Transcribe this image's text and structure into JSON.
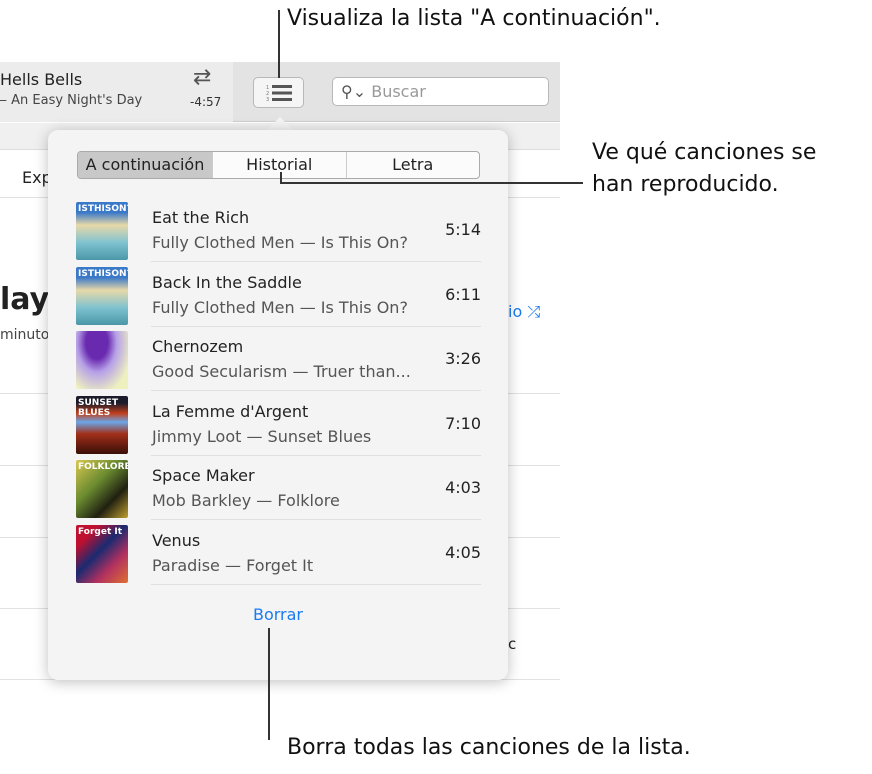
{
  "callouts": {
    "queue": "Visualiza la lista \"A continuación\".",
    "history_1": "Ve qué canciones se",
    "history_2": "han reproducido.",
    "clear": "Borra todas las canciones de la lista."
  },
  "now_playing": {
    "title": "Hells Bells",
    "subtitle": "— An Easy Night's Day",
    "remaining": "-4:57",
    "repeat_icon": "repeat-icon"
  },
  "search": {
    "placeholder": "Buscar",
    "icon": "search-icon"
  },
  "background": {
    "tab_fragment": "Exp",
    "title_fragment": "layl",
    "meta_fragment": "minuto",
    "shuffle_fragment": "io",
    "genre_fragment": "c"
  },
  "popover": {
    "tabs": [
      "A continuación",
      "Historial",
      "Letra"
    ],
    "selected_tab": "A continuación",
    "songs": [
      {
        "title": "Eat the Rich",
        "subtitle": "Fully Clothed Men — Is This On?",
        "duration": "5:14",
        "art_text": "ISTHISON?"
      },
      {
        "title": "Back In the Saddle",
        "subtitle": "Fully Clothed Men — Is This On?",
        "duration": "6:11",
        "art_text": "ISTHISON?"
      },
      {
        "title": "Chernozem",
        "subtitle": "Good Secularism — Truer than...",
        "duration": "3:26",
        "art_text": ""
      },
      {
        "title": "La Femme d'Argent",
        "subtitle": "Jimmy Loot — Sunset Blues",
        "duration": "7:10",
        "art_text": "SUNSET BLUES"
      },
      {
        "title": "Space Maker",
        "subtitle": "Mob Barkley — Folklore",
        "duration": "4:03",
        "art_text": "FOLKLORE"
      },
      {
        "title": "Venus",
        "subtitle": "Paradise — Forget It",
        "duration": "4:05",
        "art_text": "Forget It"
      }
    ],
    "clear_label": "Borrar"
  },
  "colors": {
    "accent": "#1a7bf0"
  }
}
